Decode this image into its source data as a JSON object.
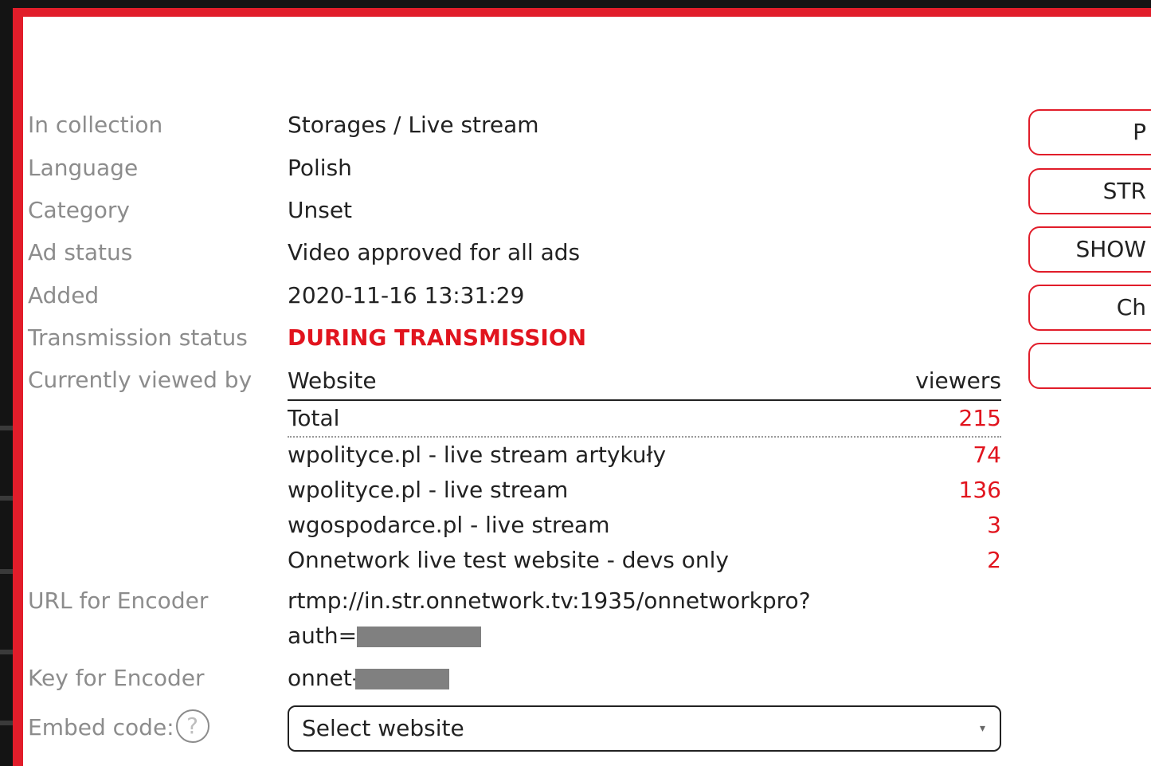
{
  "details": {
    "collection": {
      "label": "In collection",
      "value": "Storages / Live stream"
    },
    "language": {
      "label": "Language",
      "value": "Polish"
    },
    "category": {
      "label": "Category",
      "value": "Unset"
    },
    "ad_status": {
      "label": "Ad status",
      "value": "Video approved for all ads"
    },
    "added": {
      "label": "Added",
      "value": "2020-11-16 13:31:29"
    },
    "transmission_status": {
      "label": "Transmission status",
      "value": "DURING TRANSMISSION",
      "color": "#e1141e"
    },
    "viewed_by": {
      "label": "Currently viewed by"
    },
    "encoder_url": {
      "label": "URL for Encoder",
      "line1": "rtmp://in.str.onnetwork.tv:1935/onnetworkpro?",
      "line2_prefix": "auth="
    },
    "encoder_key": {
      "label": "Key for Encoder",
      "prefix": "onnet-"
    },
    "embed": {
      "label": "Embed code:",
      "help_glyph": "?",
      "select_value": "Select website",
      "caret": "▾"
    }
  },
  "viewers": {
    "header_website": "Website",
    "header_viewers": "viewers",
    "total_label": "Total",
    "total_value": "215",
    "rows": [
      {
        "site": "wpolityce.pl - live stream artykuły",
        "count": "74"
      },
      {
        "site": "wpolityce.pl - live stream",
        "count": "136"
      },
      {
        "site": "wgospodarce.pl - live stream",
        "count": "3"
      },
      {
        "site": "Onnetwork live test website - devs only",
        "count": "2"
      }
    ]
  },
  "side_buttons": [
    "P",
    "STR",
    "SHOW",
    "Ch",
    ""
  ],
  "colors": {
    "accent": "#e11d2a",
    "label": "#8c8c8c",
    "number": "#e1141e"
  }
}
